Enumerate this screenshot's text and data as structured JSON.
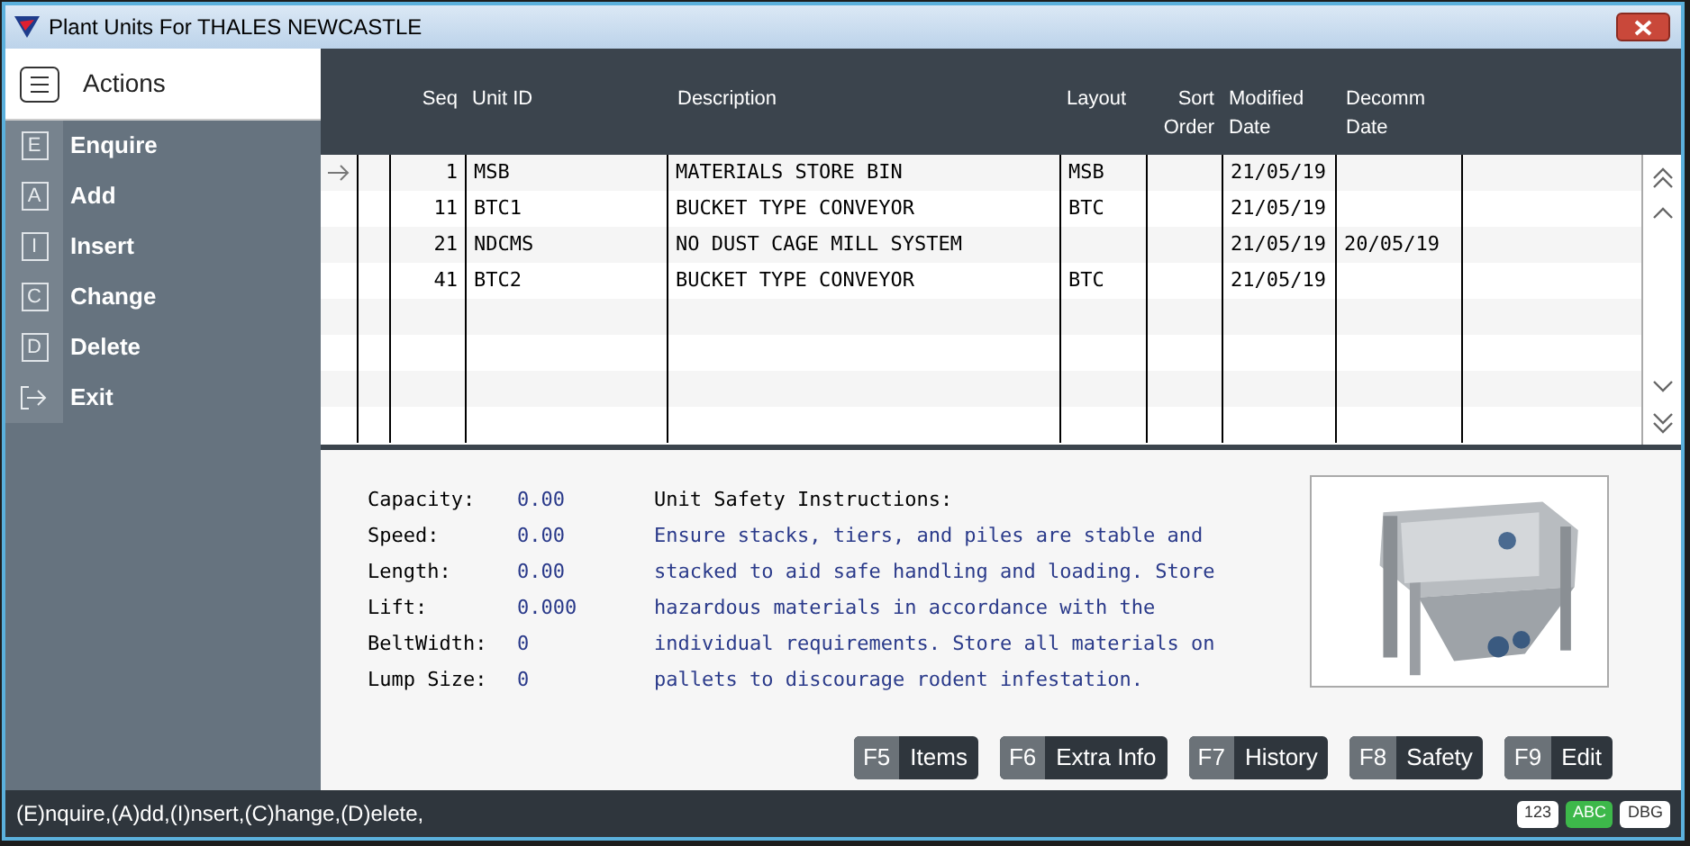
{
  "window": {
    "title": "Plant Units For THALES NEWCASTLE"
  },
  "sidebar": {
    "title": "Actions",
    "items": [
      {
        "key": "E",
        "label": "Enquire",
        "kind": "letter"
      },
      {
        "key": "A",
        "label": "Add",
        "kind": "letter"
      },
      {
        "key": "I",
        "label": "Insert",
        "kind": "letter"
      },
      {
        "key": "C",
        "label": "Change",
        "kind": "letter"
      },
      {
        "key": "D",
        "label": "Delete",
        "kind": "letter"
      },
      {
        "label": "Exit",
        "kind": "exit"
      }
    ]
  },
  "table": {
    "columns": [
      "Seq",
      "Unit ID",
      "Description",
      "Layout",
      "Sort Order",
      "Modified Date",
      "Decomm Date"
    ],
    "rows": [
      {
        "selected": true,
        "cells": [
          "1",
          "MSB",
          "MATERIALS STORE BIN",
          "MSB",
          "",
          "21/05/19",
          ""
        ]
      },
      {
        "selected": false,
        "cells": [
          "11",
          "BTC1",
          "BUCKET TYPE CONVEYOR",
          "BTC",
          "",
          "21/05/19",
          ""
        ]
      },
      {
        "selected": false,
        "cells": [
          "21",
          "NDCMS",
          "NO DUST CAGE MILL SYSTEM",
          "",
          "",
          "21/05/19",
          "20/05/19"
        ]
      },
      {
        "selected": false,
        "cells": [
          "41",
          "BTC2",
          "BUCKET TYPE CONVEYOR",
          "BTC",
          "",
          "21/05/19",
          ""
        ]
      }
    ]
  },
  "details": [
    {
      "label": "Capacity:",
      "value": "0.00"
    },
    {
      "label": "Speed:",
      "value": "0.00"
    },
    {
      "label": "Length:",
      "value": "0.00"
    },
    {
      "label": "Lift:",
      "value": "0.000"
    },
    {
      "label": "BeltWidth:",
      "value": "0"
    },
    {
      "label": "Lump Size:",
      "value": "0"
    }
  ],
  "safety": {
    "title": "Unit Safety Instructions:",
    "lines": [
      "Ensure stacks, tiers, and piles are stable and",
      "stacked to aid safe handling and loading. Store",
      "hazardous materials in accordance with the",
      "individual requirements. Store all materials on",
      "pallets to discourage rodent infestation."
    ]
  },
  "buttons": [
    {
      "key": "F5",
      "label": "Items"
    },
    {
      "key": "F6",
      "label": "Extra Info"
    },
    {
      "key": "F7",
      "label": "History"
    },
    {
      "key": "F8",
      "label": "Safety"
    },
    {
      "key": "F9",
      "label": "Edit"
    }
  ],
  "status_bar": {
    "text": "(E)nquire,(A)dd,(I)nsert,(C)hange,(D)elete,",
    "modes": [
      {
        "label": "123",
        "selected": false
      },
      {
        "label": "ABC",
        "selected": true
      },
      {
        "label": "DBG",
        "selected": false
      }
    ]
  }
}
